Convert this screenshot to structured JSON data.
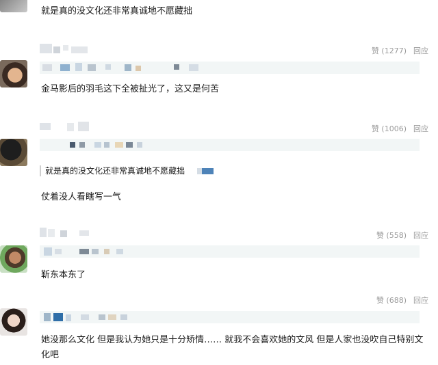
{
  "comments": [
    {
      "text": "就是真的没文化还非常真诚地不愿藏拙"
    },
    {
      "like_label": "赞",
      "like_count": "(1277)",
      "reply_label": "回应",
      "text": "金马影后的羽毛这下全被扯光了，这又是何苦"
    },
    {
      "like_label": "赞",
      "like_count": "(1006)",
      "reply_label": "回应",
      "quote": "就是真的没文化还非常真诚地不愿藏拙",
      "text": "仗着没人看瞎写一气"
    },
    {
      "like_label": "赞",
      "like_count": "(558)",
      "reply_label": "回应",
      "text": "靳东本东了"
    },
    {
      "like_label": "赞",
      "like_count": "(688)",
      "reply_label": "回应",
      "text": "她没那么文化 但是我认为她只是十分矫情…… 就我不会喜欢她的文风 但是人家也没吹自己特别文化吧"
    }
  ],
  "colors": {
    "meta_text": "#9a9a9a",
    "info_bar": "#f2f6f6",
    "body_text": "#1a1a1a"
  }
}
